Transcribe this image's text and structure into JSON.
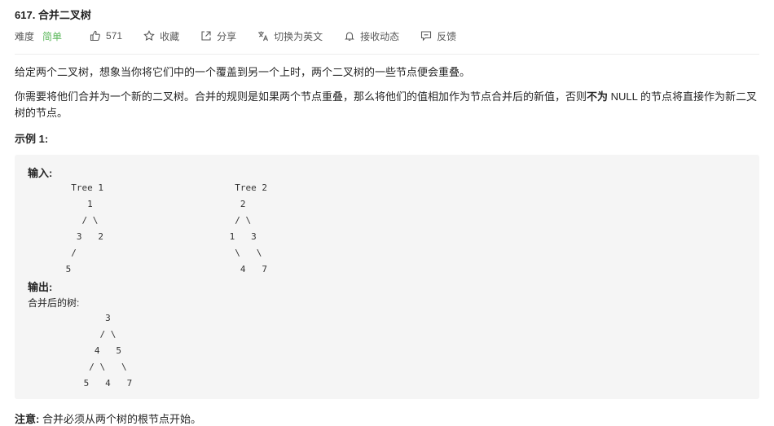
{
  "problem": {
    "title": "617. 合并二叉树"
  },
  "meta": {
    "difficulty_label": "难度",
    "difficulty_value": "简单",
    "likes": "571",
    "favorite_label": "收藏",
    "share_label": "分享",
    "translate_label": "切换为英文",
    "subscribe_label": "接收动态",
    "feedback_label": "反馈",
    "colors": {
      "difficulty_easy": "#5cb85c",
      "meta_text": "#595959"
    },
    "icons": [
      "thumbs-up-icon",
      "star-icon",
      "share-icon",
      "translate-icon",
      "bell-icon",
      "feedback-icon"
    ]
  },
  "description": {
    "p1": "给定两个二叉树，想象当你将它们中的一个覆盖到另一个上时，两个二叉树的一些节点便会重叠。",
    "p2_before": "你需要将他们合并为一个新的二叉树。合并的规则是如果两个节点重叠，那么将他们的值相加作为节点合并后的新值，否则",
    "p2_bold": "不为",
    "p2_after": " NULL 的节点将直接作为新二叉树的节点。"
  },
  "example": {
    "title": "示例 1:",
    "input_label": "输入:",
    "tree1": "  Tree 1\n     1\n    / \\\n   3   2\n  /\n 5",
    "tree2": "  Tree 2\n   2\n  / \\\n 1   3\n  \\   \\\n   4   7",
    "output_label": "输出:",
    "merged_label": "合并后的树:",
    "merged_tree": "     3\n    / \\\n   4   5\n  / \\   \\\n 5   4   7"
  },
  "note": {
    "label": "注意:",
    "text": " 合并必须从两个树的根节点开始。"
  }
}
